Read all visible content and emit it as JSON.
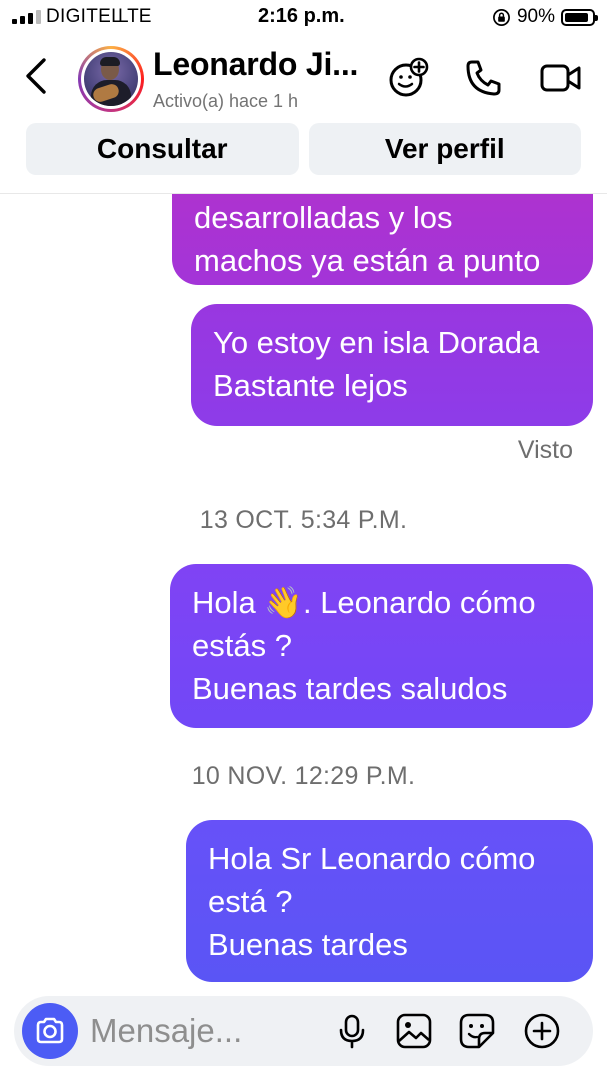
{
  "status_bar": {
    "carrier": "DIGITEL",
    "network": "LTE",
    "time": "2:16 p.m.",
    "battery_text": "90%",
    "battery_level": 0.9
  },
  "header": {
    "contact_name": "Leonardo Ji...",
    "contact_status": "Activo(a) hace 1 h",
    "icons": [
      "back-icon",
      "avatar",
      "effects-icon",
      "phone-icon",
      "video-icon"
    ]
  },
  "actions": {
    "consult_label": "Consultar",
    "profile_label": "Ver perfil"
  },
  "messages": [
    {
      "lines": [
        "desarrolladas y los",
        "machos ya están a punto"
      ]
    },
    {
      "lines": [
        "Yo estoy en isla Dorada",
        "Bastante lejos"
      ]
    },
    {
      "lines": [
        "Hola 👋. Leonardo cómo",
        "estás ?",
        "Buenas tardes saludos"
      ]
    },
    {
      "lines": [
        "Hola Sr Leonardo cómo",
        "está ?",
        "Buenas tardes"
      ]
    }
  ],
  "seen_label": "Visto",
  "timestamps": [
    "13 OCT. 5:34 P.M.",
    "10 NOV. 12:29 P.M."
  ],
  "composer": {
    "placeholder": "Mensaje...",
    "icons": [
      "camera-icon",
      "microphone-icon",
      "gallery-icon",
      "sticker-icon",
      "plus-icon"
    ]
  },
  "colors": {
    "accent": "#4c5cf5",
    "bubble_top": "#b232cc",
    "bubble_bottom": "#5a55f5"
  }
}
